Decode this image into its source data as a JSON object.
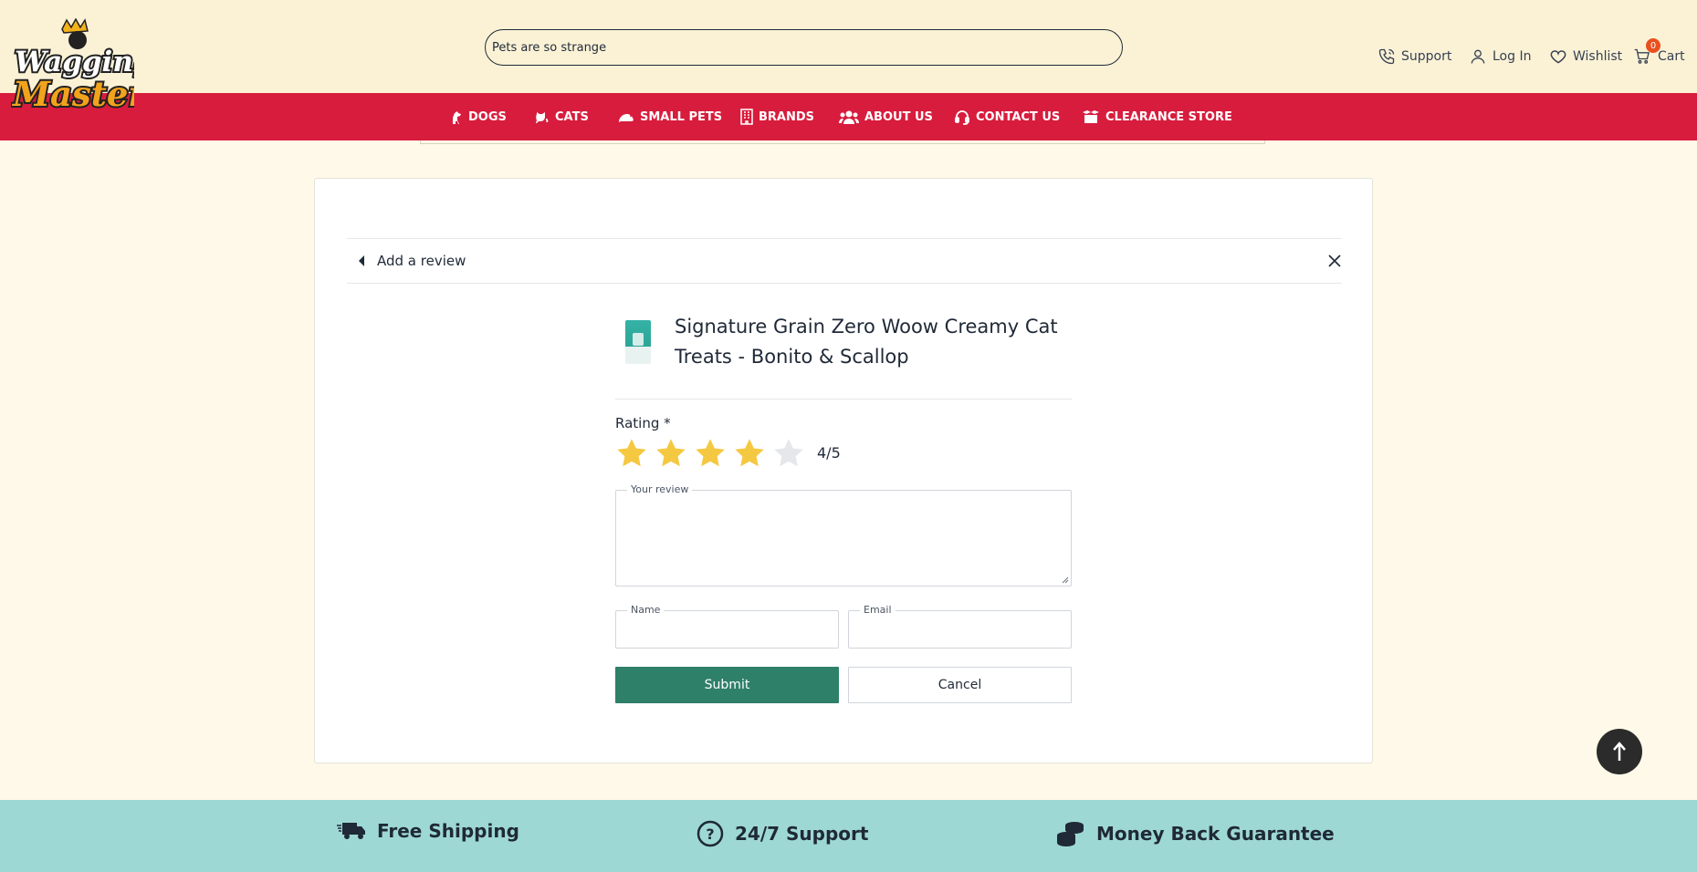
{
  "header": {
    "logo_text_top": "Wagging",
    "logo_text_bottom": "Master",
    "search_value": "Pets are so strange",
    "support_label": "Support",
    "login_label": "Log In",
    "wishlist_label": "Wishlist",
    "cart_label": "Cart",
    "cart_count": "0"
  },
  "nav": {
    "items": [
      {
        "label": "DOGS",
        "icon": "dog-icon"
      },
      {
        "label": "CATS",
        "icon": "cat-icon"
      },
      {
        "label": "SMALL PETS",
        "icon": "small-pet-icon"
      },
      {
        "label": "BRANDS",
        "icon": "building-icon"
      },
      {
        "label": "ABOUT US",
        "icon": "users-icon"
      },
      {
        "label": "CONTACT US",
        "icon": "headset-icon"
      },
      {
        "label": "CLEARANCE STORE",
        "icon": "box-icon"
      }
    ]
  },
  "review": {
    "header_title": "Add a review",
    "product_title": "Signature Grain Zero Woow Creamy Cat Treats - Bonito & Scallop",
    "rating_label": "Rating *",
    "rating_value": 4,
    "rating_max": 5,
    "rating_text": "4/5",
    "review_label": "Your review",
    "review_value": "",
    "name_label": "Name",
    "name_value": "",
    "email_label": "Email",
    "email_value": "",
    "submit_label": "Submit",
    "cancel_label": "Cancel"
  },
  "features": {
    "items": [
      {
        "label": "Free Shipping",
        "icon": "truck-icon"
      },
      {
        "label": "24/7 Support",
        "icon": "question-circle-icon"
      },
      {
        "label": "Money Back Guarantee",
        "icon": "coins-icon"
      }
    ]
  },
  "colors": {
    "nav_bg": "#d81c3d",
    "topbar_bg": "#fbf2d6",
    "submit_bg": "#2e8068",
    "star_filled": "#f5c842",
    "star_empty": "#e5e7eb",
    "footer_bg": "#9ed8d5"
  }
}
